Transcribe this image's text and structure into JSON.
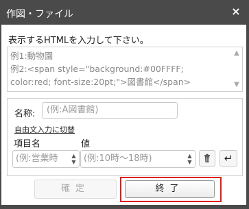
{
  "window": {
    "title": "作図・ファイル",
    "close": "×"
  },
  "instruction": "表示するHTMLを入力して下さい。",
  "html_input": {
    "placeholder": "例1:動物園\n例2:<span style=\"background:#00FFFF; color:red; font-size:20pt;\">図書館</span>"
  },
  "name": {
    "label": "名称:",
    "placeholder": "(例:A図書館)"
  },
  "toggle_link": "自由文入力に切替",
  "columns": {
    "item": "項目名",
    "value": "値"
  },
  "item_select": {
    "placeholder": "(例:営業時"
  },
  "value_select": {
    "placeholder": "(例:10時〜18時)"
  },
  "icons": {
    "trash": "trash-icon",
    "enter": "enter-icon"
  },
  "buttons": {
    "confirm": "確定",
    "finish": "終了"
  },
  "colors": {
    "title_bar": "#4a4a4a",
    "highlight": "#e31b1b"
  }
}
